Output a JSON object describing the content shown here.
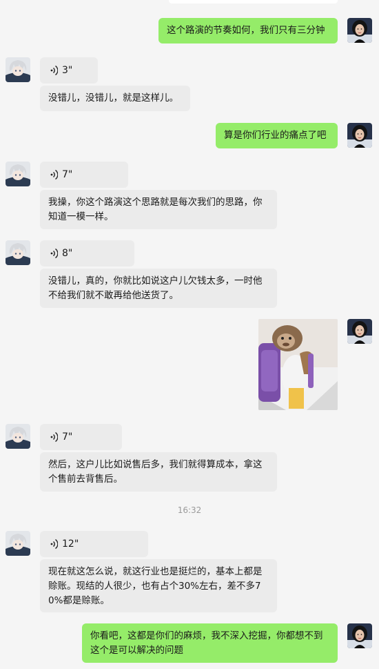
{
  "timestamp": "16:32",
  "messages": {
    "m1_text": "这个路演的节奏如何，我们只有三分钟",
    "m2_duration": "3\"",
    "m3_text": "没错儿，没错儿，就是这样儿。",
    "m4_text": "算是你们行业的痛点了吧",
    "m5_duration": "7\"",
    "m6_text": "我操，你这个路演这个思路就是每次我们的思路，你知道一模一样。",
    "m7_duration": "8\"",
    "m8_text": "没错儿，真的，你就比如说这户儿欠钱太多，一时他不给我们就不敢再给他送货了。",
    "m10_duration": "7\"",
    "m11_text": "然后，这户儿比如说售后多，我们就得算成本，拿这个售前去背售后。",
    "m12_duration": "12\"",
    "m13_text": "现在就这怎么说，就这行业也是挺烂的，基本上都是赊账。现结的人很少，也有占个30%左右，差不多70%都是赊账。",
    "m14_text": "你看吧，这都是你们的麻烦，我不深入挖掘，你都想不到这个是可以解决的问题"
  },
  "colors": {
    "outgoing_bubble": "#95ec69",
    "incoming_bubble": "#ebebeb",
    "background": "#f5f5f5"
  },
  "icons": {
    "voice": "voice-wave-icon",
    "me_avatar": "woman-portrait-avatar",
    "other_avatar": "anime-character-avatar",
    "sticker": "monkey-with-backpack-sticker"
  }
}
